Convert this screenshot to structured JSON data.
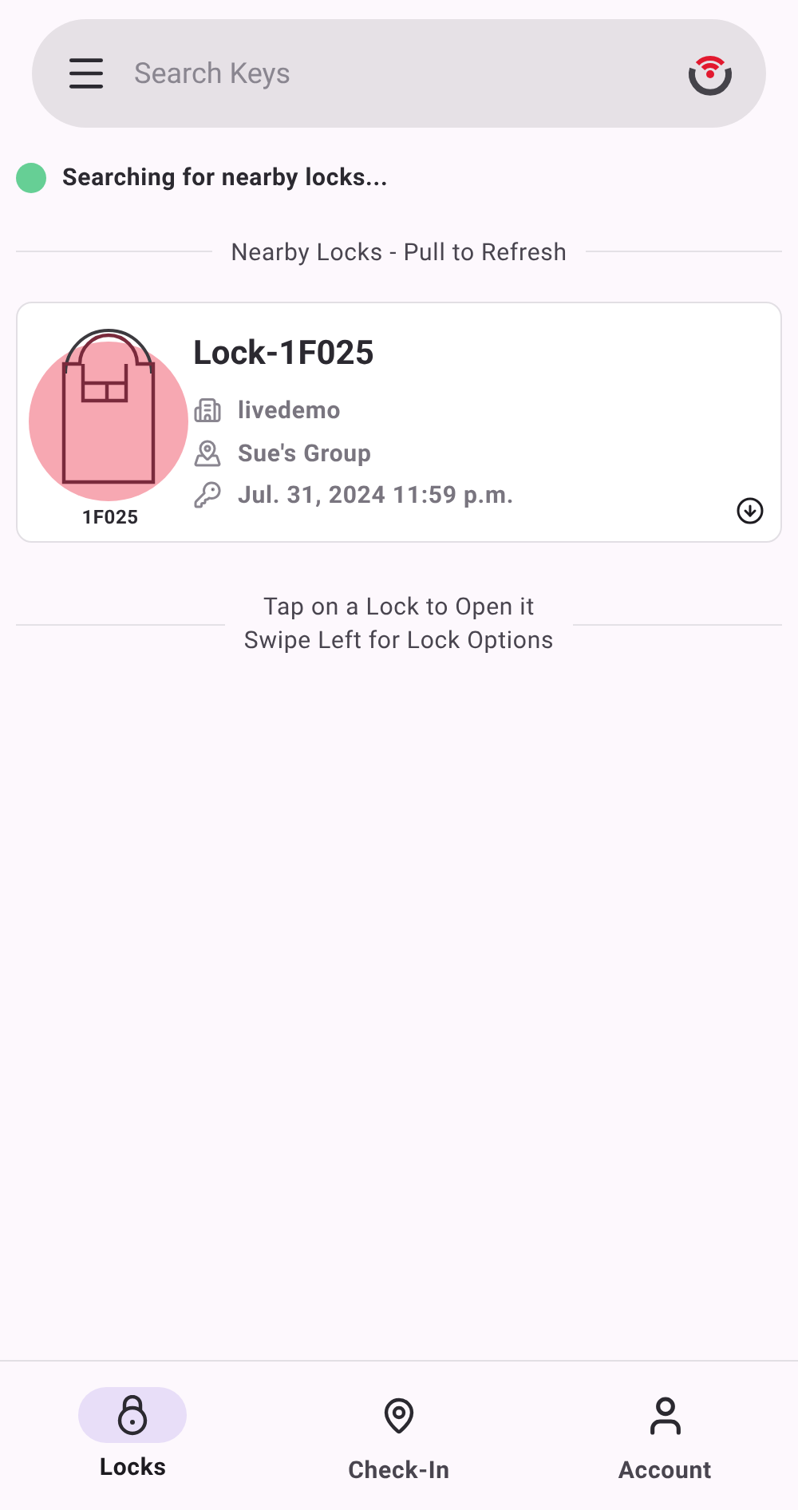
{
  "search": {
    "placeholder": "Search Keys"
  },
  "status": {
    "text": "Searching for nearby locks...",
    "color": "#66cf95"
  },
  "section_title": "Nearby Locks - Pull to Refresh",
  "locks": [
    {
      "name": "Lock-1F025",
      "code": "1F025",
      "color": "#f7a8b2",
      "organization": "livedemo",
      "group": "Sue's Group",
      "expires": "Jul. 31, 2024 11:59 p.m."
    }
  ],
  "hint": [
    "Tap on a Lock to Open it",
    "Swipe Left for Lock Options"
  ],
  "nav": [
    {
      "kind": "locks",
      "label": "Locks",
      "selected": true
    },
    {
      "kind": "checkin",
      "label": "Check-In",
      "selected": false
    },
    {
      "kind": "account",
      "label": "Account",
      "selected": false
    }
  ]
}
